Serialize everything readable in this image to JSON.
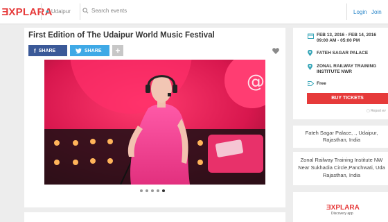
{
  "header": {
    "logo_mark": "E",
    "logo_rest": "XPLARA",
    "location": "Udaipur",
    "search_placeholder": "Search events",
    "login": "Login",
    "join": "Join"
  },
  "event": {
    "title": "First Edition of The Udaipur World Music Festival",
    "share_facebook": "SHARE",
    "share_twitter": "SHARE",
    "more": "+"
  },
  "gallery": {
    "slides": 5,
    "active_index": 4
  },
  "details": {
    "date_line1": "FEB 13, 2016 - FEB 14, 2016",
    "date_line2": "09:00 AM - 05:00 PM",
    "venue1": "FATEH SAGAR PALACE",
    "venue2_line1": "ZONAL RAILWAY TRAINING",
    "venue2_line2": "INSTITUTE NWR",
    "price": "Free",
    "buy_button": "BUY TICKETS",
    "report": "Report ev"
  },
  "addresses": {
    "a1_line1": "Fateh Sagar Palace, ., Udaipur,",
    "a1_line2": "Rajasthan, India",
    "a2_line1": "Zonal Railway Training Institute NW",
    "a2_line2": "Near Sukhadia Circle,Panchwati, Uda",
    "a2_line3": "Rajasthan, India"
  },
  "promo": {
    "logo_mark": "E",
    "logo_rest": "XPLARA",
    "tagline": "Discovery app"
  },
  "colors": {
    "brand": "#e63a3a",
    "link": "#2a86c9",
    "facebook": "#3b5998",
    "twitter": "#3fa9e6",
    "pin": "#3aa7b9"
  }
}
